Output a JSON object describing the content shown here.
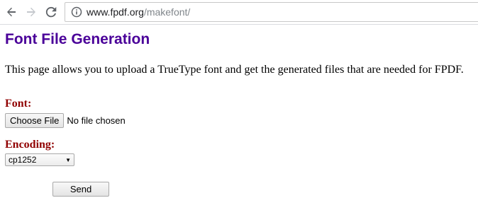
{
  "browser": {
    "url_host": "www.fpdf.org",
    "url_path": "/makefont/",
    "icons": {
      "back": "back-arrow-icon",
      "forward": "forward-arrow-icon",
      "reload": "reload-icon",
      "site_info": "info-icon"
    }
  },
  "page": {
    "title": "Font File Generation",
    "intro": "This page allows you to upload a TrueType font and get the generated files that are needed for FPDF.",
    "font_label": "Font:",
    "choose_file_label": "Choose File",
    "file_status": "No file chosen",
    "encoding_label": "Encoding:",
    "encoding_selected": "cp1252",
    "send_label": "Send"
  },
  "colors": {
    "title": "#4a0099",
    "label": "#900000",
    "url_path": "#80868b"
  }
}
